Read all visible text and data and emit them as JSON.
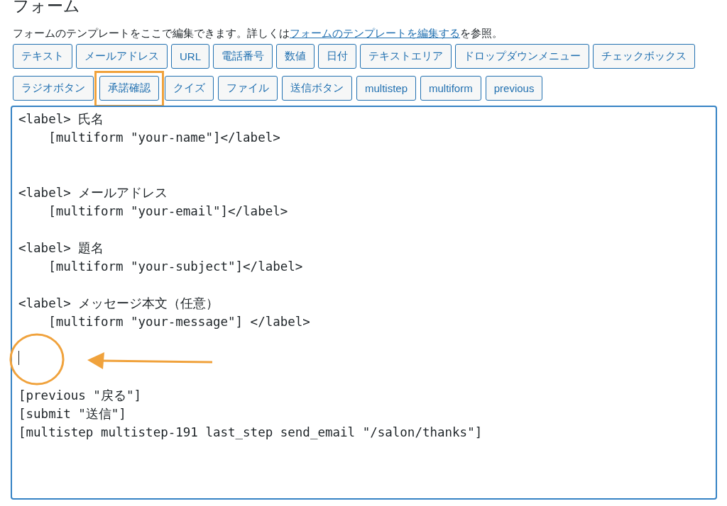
{
  "title": "フォーム",
  "description": {
    "before": "フォームのテンプレートをここで編集できます。詳しくは",
    "link": "フォームのテンプレートを編集する",
    "after": "を参照。"
  },
  "tag_rows": [
    [
      {
        "label": "テキスト",
        "highlighted": false
      },
      {
        "label": "メールアドレス",
        "highlighted": false
      },
      {
        "label": "URL",
        "highlighted": false
      },
      {
        "label": "電話番号",
        "highlighted": false
      },
      {
        "label": "数値",
        "highlighted": false
      },
      {
        "label": "日付",
        "highlighted": false
      },
      {
        "label": "テキストエリア",
        "highlighted": false
      },
      {
        "label": "ドロップダウンメニュー",
        "highlighted": false
      },
      {
        "label": "チェックボックス",
        "highlighted": false
      }
    ],
    [
      {
        "label": "ラジオボタン",
        "highlighted": false
      },
      {
        "label": "承諾確認",
        "highlighted": true
      },
      {
        "label": "クイズ",
        "highlighted": false
      },
      {
        "label": "ファイル",
        "highlighted": false
      },
      {
        "label": "送信ボタン",
        "highlighted": false
      },
      {
        "label": "multistep",
        "highlighted": false
      },
      {
        "label": "multiform",
        "highlighted": false
      },
      {
        "label": "previous",
        "highlighted": false
      }
    ]
  ],
  "editor": {
    "text_before_cursor": "<label> 氏名\n    [multiform \"your-name\"]</label>\n\n\n<label> メールアドレス\n    [multiform \"your-email\"]</label>\n\n<label> 題名\n    [multiform \"your-subject\"]</label>\n\n<label> メッセージ本文（任意）\n    [multiform \"your-message\"] </label>\n\n",
    "text_after_cursor": "\n\n[previous \"戻る\"]\n[submit \"送信\"]\n[multistep multistep-191 last_step send_email \"/salon/thanks\"]",
    "focused": true
  },
  "annotations": {
    "cursor_circle": true,
    "arrow": true
  }
}
